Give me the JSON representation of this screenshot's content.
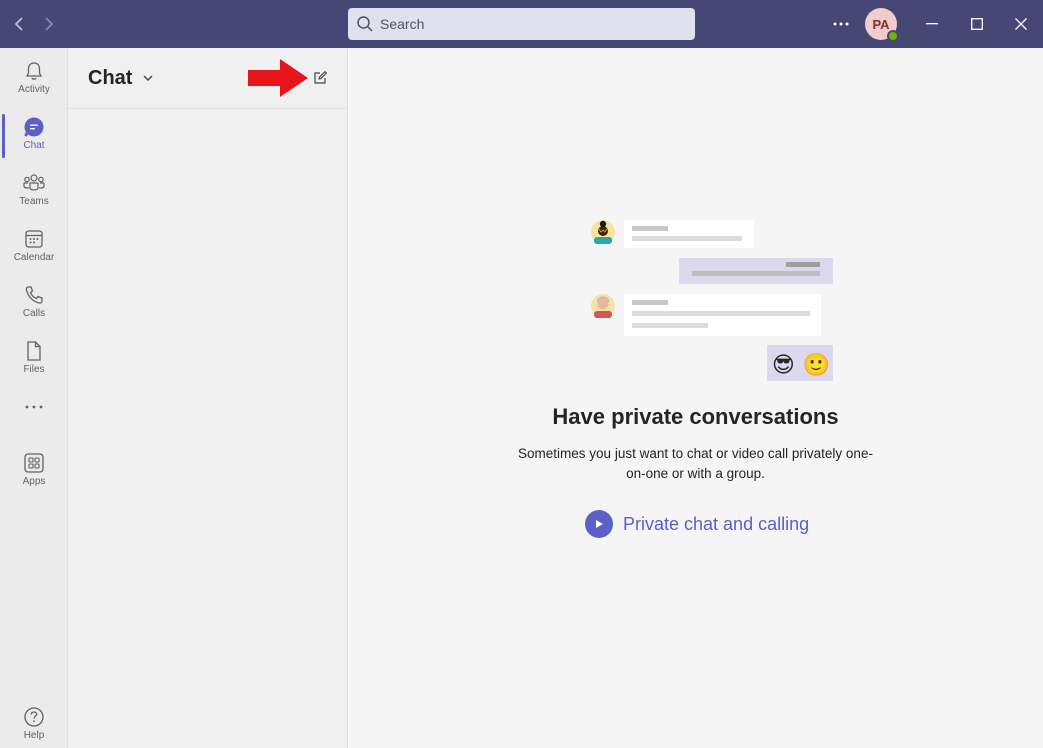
{
  "titlebar": {
    "search_placeholder": "Search",
    "avatar_initials": "PA",
    "presence_status": "available"
  },
  "appbar": {
    "items": [
      {
        "label": "Activity",
        "icon": "bell-icon"
      },
      {
        "label": "Chat",
        "icon": "chat-bubble-icon",
        "active": true
      },
      {
        "label": "Teams",
        "icon": "teams-icon"
      },
      {
        "label": "Calendar",
        "icon": "calendar-icon"
      },
      {
        "label": "Calls",
        "icon": "phone-icon"
      },
      {
        "label": "Files",
        "icon": "file-icon"
      },
      {
        "label": "",
        "icon": "more-icon"
      },
      {
        "label": "Apps",
        "icon": "apps-icon"
      },
      {
        "label": "Help",
        "icon": "help-icon"
      }
    ]
  },
  "chatlist": {
    "title": "Chat"
  },
  "main": {
    "heading": "Have private conversations",
    "description": "Sometimes you just want to chat or video call privately one-on-one or with a group.",
    "cta_label": "Private chat and calling",
    "emojis": [
      "😎",
      "🙂"
    ]
  },
  "colors": {
    "titlebar": "#464775",
    "accent": "#5b5fc7",
    "annotation_arrow": "#e8141b"
  }
}
